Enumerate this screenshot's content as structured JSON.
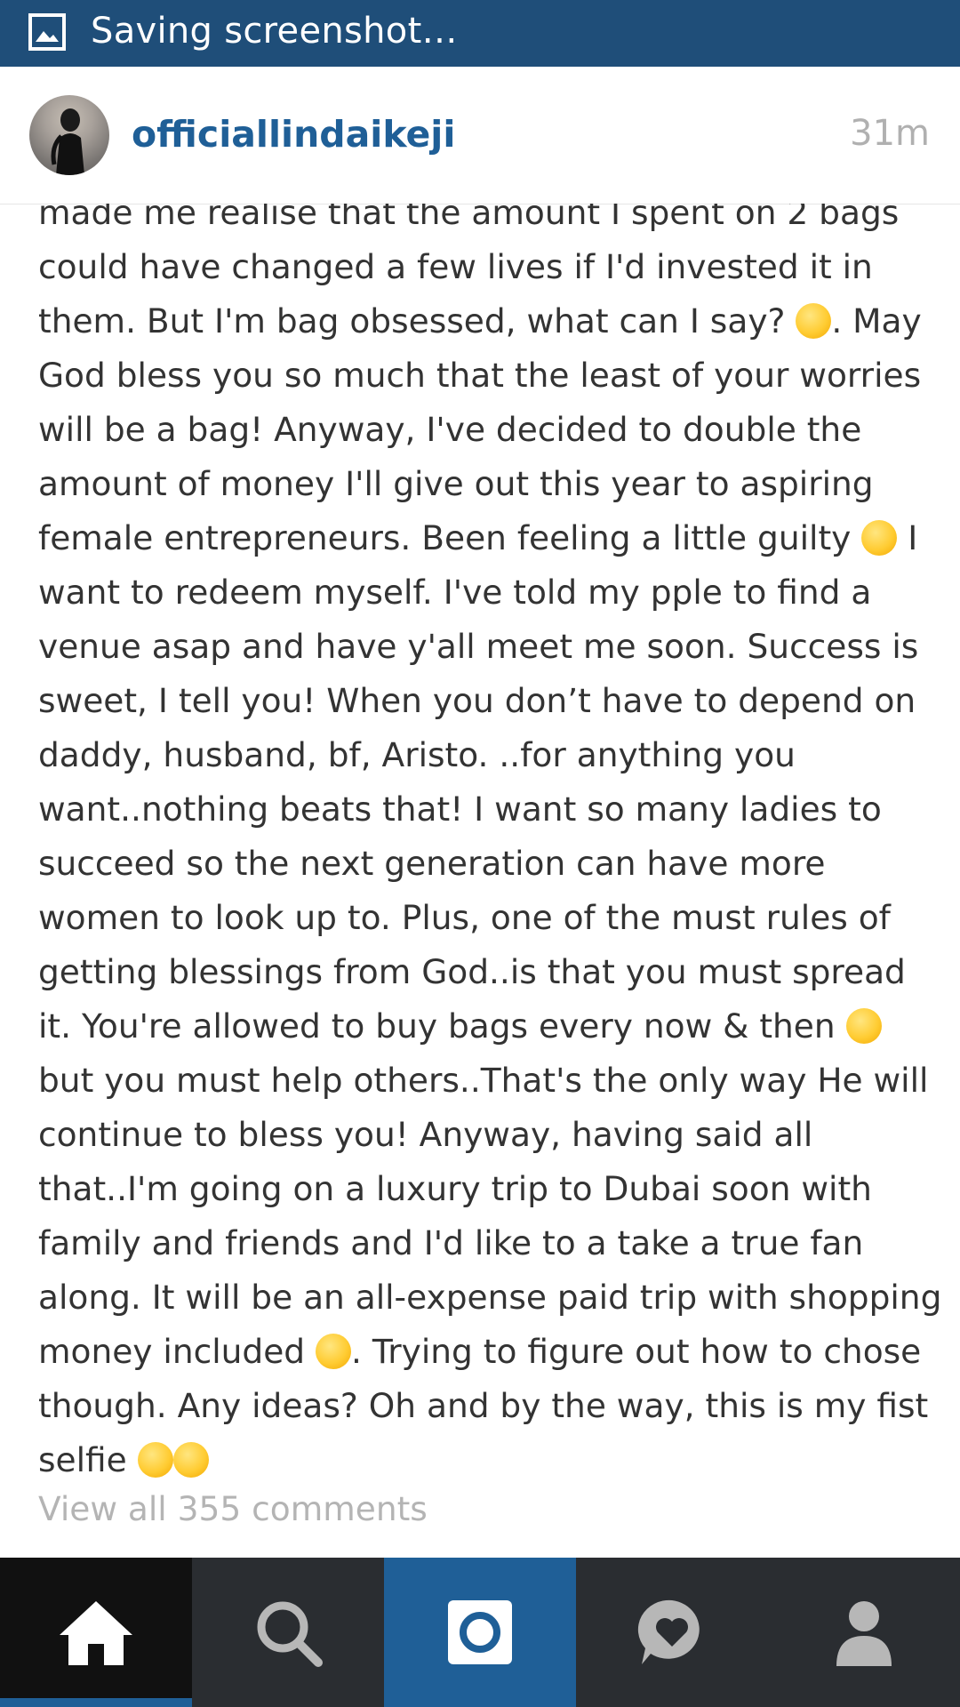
{
  "status_bar": {
    "notification_icon": "image-icon",
    "text": "Saving screenshot…"
  },
  "post": {
    "username": "officiallindaikeji",
    "time_ago": "31m",
    "avatar": "profile-photo"
  },
  "caption_lines": [
    "made me realise that the amount I spent on 2 bags",
    "could have changed a few lives if I'd invested it in",
    "them. But I'm bag obsessed, what can I say? ",
    "God bless you so much that the least of your worries",
    "will be a bag! Anyway, I've decided to double the",
    "amount of money I'll give out this year to aspiring",
    "female entrepreneurs. Been feeling a little guilty ",
    "want to redeem myself. I've told my pple to find a",
    "venue asap and have y'all meet me soon. Success is",
    "sweet, I tell you! When you don’t have to depend on",
    "daddy, husband, bf, Aristo. ..for anything you",
    "want..nothing beats that! I want so many ladies to",
    "succeed so the next generation can have more",
    "women to look up to. Plus, one of the must rules of",
    "getting blessings from God..is that you must spread",
    "it. You're allowed to buy bags every now & then ",
    "but you must help others..That's the only way He will",
    "continue to bless you! Anyway, having said all",
    "that..I'm going on a luxury trip to Dubai soon with",
    "family and friends and I'd like to a take a true fan",
    "along. It will be an all-expense paid trip with shopping",
    "money included ",
    "though. Any ideas? Oh and by the way, this is my fist",
    "selfie "
  ],
  "caption_suffixes": {
    "line3": ". May",
    "line7": " I",
    "line22": ". Trying to figure out how to chose"
  },
  "view_comments": "View all 355 comments",
  "bottom_nav": {
    "items": [
      "home-icon",
      "search-icon",
      "camera-icon",
      "activity-icon",
      "profile-icon"
    ],
    "active": "home"
  },
  "colors": {
    "status_bar": "#1f4e79",
    "link": "#1f5f97",
    "nav_dark": "#2a2d31",
    "nav_active": "#1f5f97"
  }
}
